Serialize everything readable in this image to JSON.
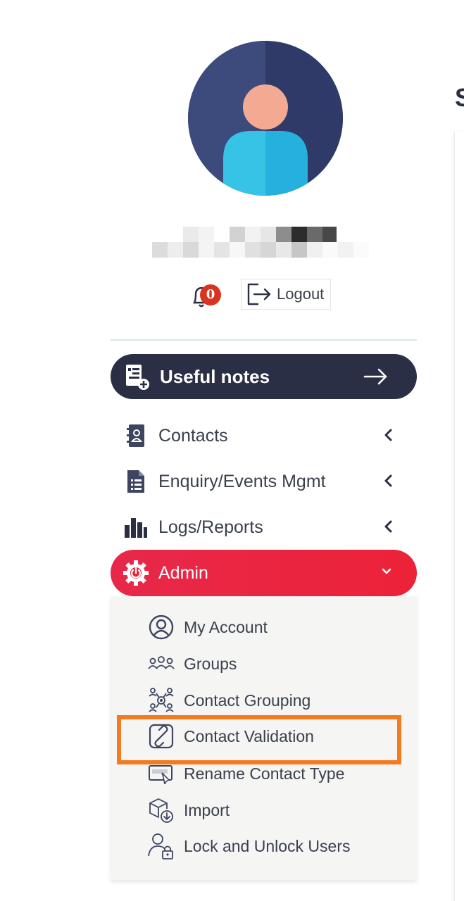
{
  "user": {
    "name_redacted": true,
    "avatar": "user-avatar-icon"
  },
  "notifications": {
    "count": "0",
    "icon": "bell-icon"
  },
  "logout": {
    "label": "Logout",
    "icon": "logout-icon"
  },
  "useful_notes": {
    "label": "Useful notes",
    "icon": "notes-icon"
  },
  "menu": {
    "contacts": {
      "label": "Contacts",
      "icon": "contacts-book-icon"
    },
    "enquiry": {
      "label": "Enquiry/Events Mgmt",
      "icon": "document-list-icon"
    },
    "logs": {
      "label": "Logs/Reports",
      "icon": "bar-chart-icon"
    },
    "admin": {
      "label": "Admin",
      "icon": "gear-power-icon",
      "expanded": true
    }
  },
  "admin_submenu": [
    {
      "label": "My Account",
      "icon": "user-circle-icon"
    },
    {
      "label": "Groups",
      "icon": "groups-icon"
    },
    {
      "label": "Contact Grouping",
      "icon": "contact-grouping-icon"
    },
    {
      "label": "Contact Validation",
      "icon": "link-validation-icon",
      "highlighted": true
    },
    {
      "label": "Rename Contact Type",
      "icon": "rename-icon"
    },
    {
      "label": "Import",
      "icon": "import-box-icon"
    },
    {
      "label": "Lock and Unlock Users",
      "icon": "user-lock-icon"
    }
  ],
  "page": {
    "heading_fragment": "S"
  },
  "colors": {
    "navy": "#2b2f45",
    "admin_red": "#ec2238",
    "highlight_orange": "#f47a20",
    "badge_red": "#d9341f"
  }
}
